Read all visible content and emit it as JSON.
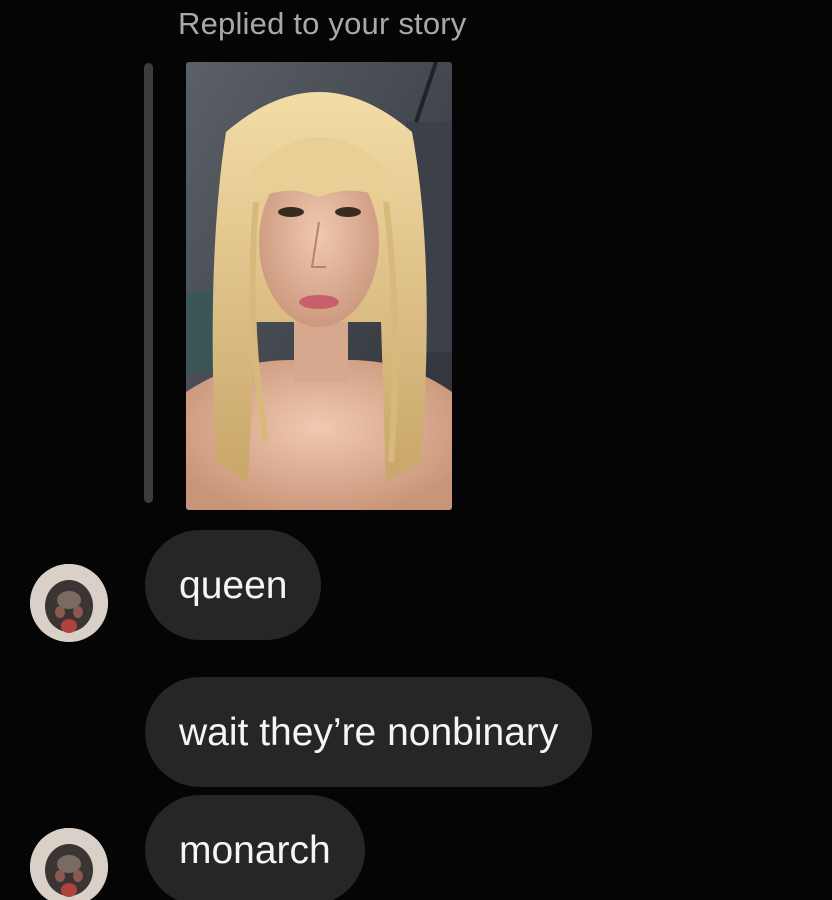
{
  "reply": {
    "label": "Replied to your story"
  },
  "story": {
    "thumbnail_icon": "story-photo-thumbnail"
  },
  "messages": [
    {
      "text": "queen",
      "has_avatar": true
    },
    {
      "text": "wait they’re nonbinary",
      "has_avatar": false
    },
    {
      "text": "monarch",
      "has_avatar": true
    }
  ],
  "colors": {
    "background": "#050505",
    "bubble": "#262626",
    "bubble_text": "#f5f5f5",
    "reply_label": "#a8a8a8",
    "reply_bar": "#3b3b3b"
  }
}
